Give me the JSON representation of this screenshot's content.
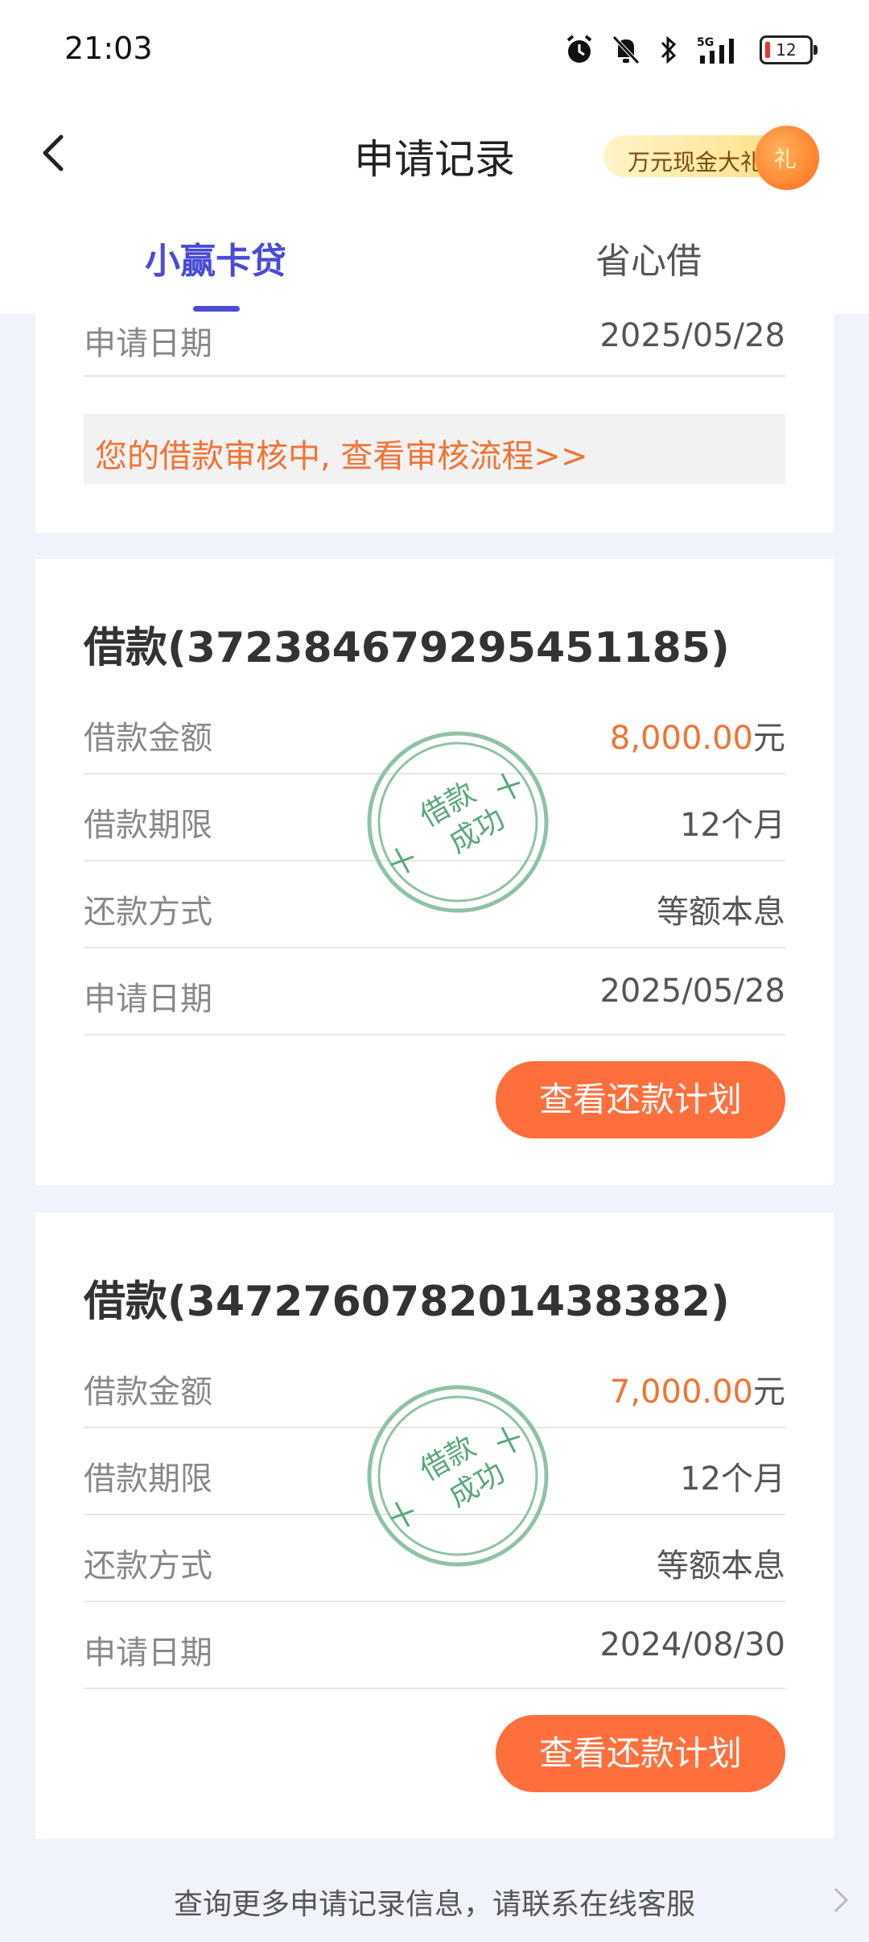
{
  "status": {
    "time": "21:03",
    "battery": "12",
    "icons": [
      "alarm-icon",
      "mute-icon",
      "bluetooth-icon",
      "5g-signal-icon",
      "battery-icon"
    ]
  },
  "header": {
    "title": "申请记录",
    "promo_label": "万元现金大礼",
    "promo_badge": "礼"
  },
  "tabs": [
    {
      "label": "小赢卡贷",
      "active": true
    },
    {
      "label": "省心借",
      "active": false
    }
  ],
  "card_top": {
    "date_label": "申请日期",
    "date_value": "2025/05/28",
    "notice": "您的借款审核中, 查看审核流程>>"
  },
  "loans": [
    {
      "title": "借款(372384679295451185)",
      "amount_label": "借款金额",
      "amount": "8,000.00",
      "amount_unit": "元",
      "term_label": "借款期限",
      "term": "12个月",
      "method_label": "还款方式",
      "method": "等额本息",
      "date_label": "申请日期",
      "date": "2025/05/28",
      "stamp_line1": "借款",
      "stamp_line2": "成功",
      "button": "查看还款计划"
    },
    {
      "title": "借款(347276078201438382)",
      "amount_label": "借款金额",
      "amount": "7,000.00",
      "amount_unit": "元",
      "term_label": "借款期限",
      "term": "12个月",
      "method_label": "还款方式",
      "method": "等额本息",
      "date_label": "申请日期",
      "date": "2024/08/30",
      "stamp_line1": "借款",
      "stamp_line2": "成功",
      "button": "查看还款计划"
    }
  ],
  "footer": {
    "text": "查询更多申请记录信息，请联系在线客服"
  },
  "colors": {
    "accent": "#4a4bd6",
    "amount": "#f27333",
    "button": "#ff6f3c",
    "stamp": "#5aa87c"
  }
}
